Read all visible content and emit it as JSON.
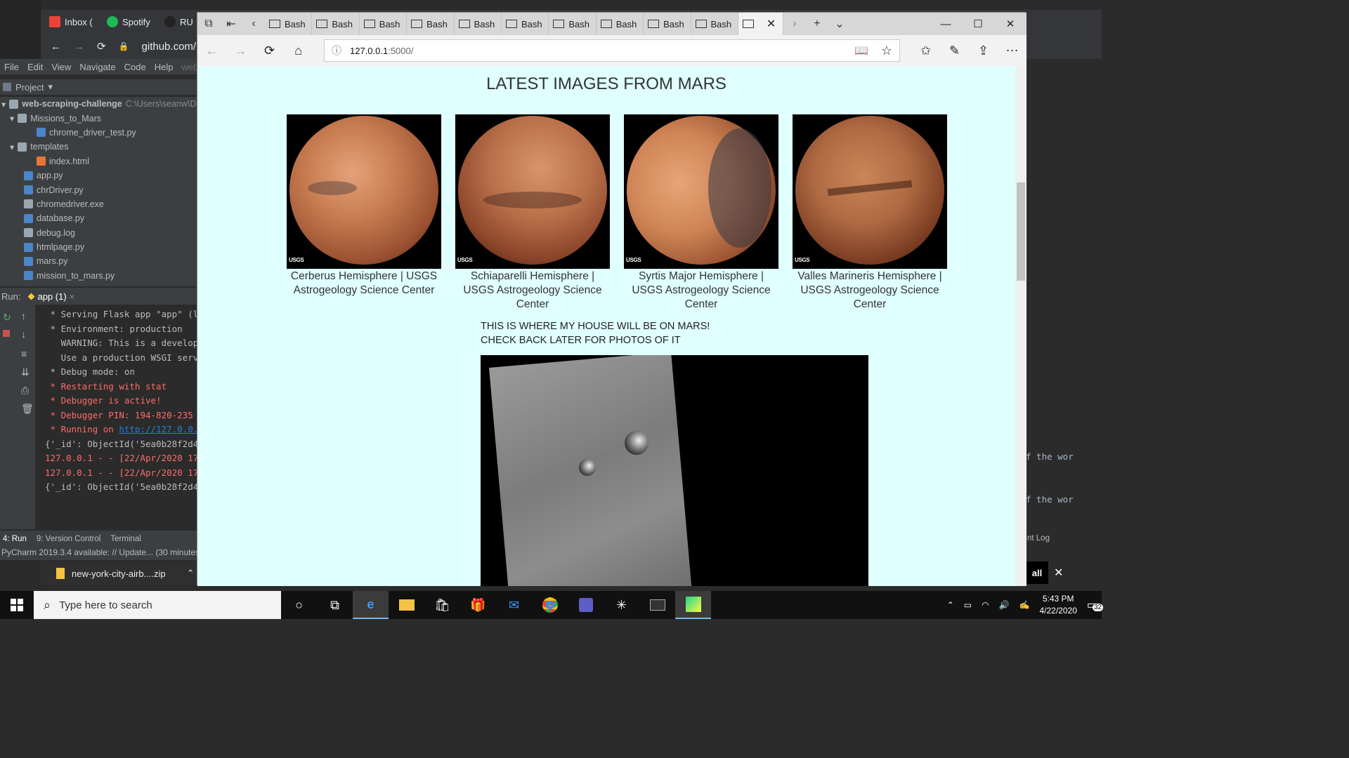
{
  "chrome": {
    "tabs": [
      "Inbox (",
      "Spotify",
      "RU"
    ],
    "url": "github.com/"
  },
  "pycharm": {
    "menu": [
      "File",
      "Edit",
      "View",
      "Navigate",
      "Code",
      "Help",
      "web"
    ],
    "project_label": "Project",
    "tree": [
      {
        "name": "web-scraping-challenge",
        "extra": "C:\\Users\\seanw\\Des",
        "level": 0,
        "type": "folder-open"
      },
      {
        "name": "Missions_to_Mars",
        "extra": "",
        "level": 1,
        "type": "folder-open"
      },
      {
        "name": "chrome_driver_test.py",
        "extra": "",
        "level": 2,
        "type": "py"
      },
      {
        "name": "templates",
        "extra": "",
        "level": 1,
        "type": "folder-open"
      },
      {
        "name": "index.html",
        "extra": "",
        "level": 2,
        "type": "html"
      },
      {
        "name": "app.py",
        "extra": "",
        "level": 1,
        "type": "py"
      },
      {
        "name": "chrDriver.py",
        "extra": "",
        "level": 1,
        "type": "py"
      },
      {
        "name": "chromedriver.exe",
        "extra": "",
        "level": 1,
        "type": "file"
      },
      {
        "name": "database.py",
        "extra": "",
        "level": 1,
        "type": "py"
      },
      {
        "name": "debug.log",
        "extra": "",
        "level": 1,
        "type": "file"
      },
      {
        "name": "htmlpage.py",
        "extra": "",
        "level": 1,
        "type": "py"
      },
      {
        "name": "mars.py",
        "extra": "",
        "level": 1,
        "type": "py"
      },
      {
        "name": "mission_to_mars.py",
        "extra": "",
        "level": 1,
        "type": "py"
      }
    ],
    "run_label": "Run:",
    "run_tab": "app (1)",
    "console": [
      {
        "text": " * Serving Flask app \"app\" (la",
        "color": "#bbbbbb"
      },
      {
        "text": " * Environment: production",
        "color": "#bbbbbb"
      },
      {
        "text": "   WARNING: This is a developm",
        "color": "#bbbbbb"
      },
      {
        "text": "   Use a production WSGI serve",
        "color": "#bbbbbb"
      },
      {
        "text": " * Debug mode: on",
        "color": "#bbbbbb"
      },
      {
        "text": " * Restarting with stat",
        "color": "#ff6b68"
      },
      {
        "text": " * Debugger is active!",
        "color": "#ff6b68"
      },
      {
        "text": " * Debugger PIN: 194-820-235",
        "color": "#ff6b68"
      },
      {
        "text": " * Running on ",
        "color": "#ff6b68",
        "link": "http://127.0.0.1"
      },
      {
        "text": "{'_id': ObjectId('5ea0b28f2d49",
        "color": "#bbbbbb"
      },
      {
        "text": "127.0.0.1 - - [22/Apr/2020 17",
        "color": "#ff6b68"
      },
      {
        "text": "127.0.0.1 - - [22/Apr/2020 17",
        "color": "#ff6b68"
      },
      {
        "text": "{'_id': ObjectId('5ea0b28f2d49",
        "color": "#bbbbbb"
      }
    ],
    "bottom_tabs": [
      "4: Run",
      "9: Version Control",
      "Terminal"
    ],
    "status": "PyCharm 2019.3.4 available: // Update... (30 minutes",
    "right_console": [
      "f the wor",
      "f the wor"
    ],
    "right_log": "nt Log",
    "right_button": "all"
  },
  "download": {
    "file": "new-york-city-airb....zip"
  },
  "edge": {
    "tab_label": "Bash",
    "tab_count": 10,
    "url_host": "127.0.0.1",
    "url_port": ":5000/"
  },
  "page": {
    "title": "LATEST IMAGES FROM MARS",
    "hemispheres": [
      {
        "caption": "Cerberus Hemisphere | USGS Astrogeology Science Center",
        "label": "USGS"
      },
      {
        "caption": "Schiaparelli Hemisphere | USGS Astrogeology Science Center",
        "label": "USGS"
      },
      {
        "caption": "Syrtis Major Hemisphere | USGS Astrogeology Science Center",
        "label": "USGS"
      },
      {
        "caption": "Valles Marineris Hemisphere | USGS Astrogeology Science Center",
        "label": "USGS"
      }
    ],
    "house_line1": "THIS IS WHERE MY HOUSE WILL BE ON MARS!",
    "house_line2": "CHECK BACK LATER FOR PHOTOS OF IT"
  },
  "taskbar": {
    "search_placeholder": "Type here to search",
    "time": "5:43 PM",
    "date": "4/22/2020",
    "notifications": "32"
  },
  "colors": {
    "page_bg": "#e0ffff",
    "mars": "#c1683c"
  }
}
